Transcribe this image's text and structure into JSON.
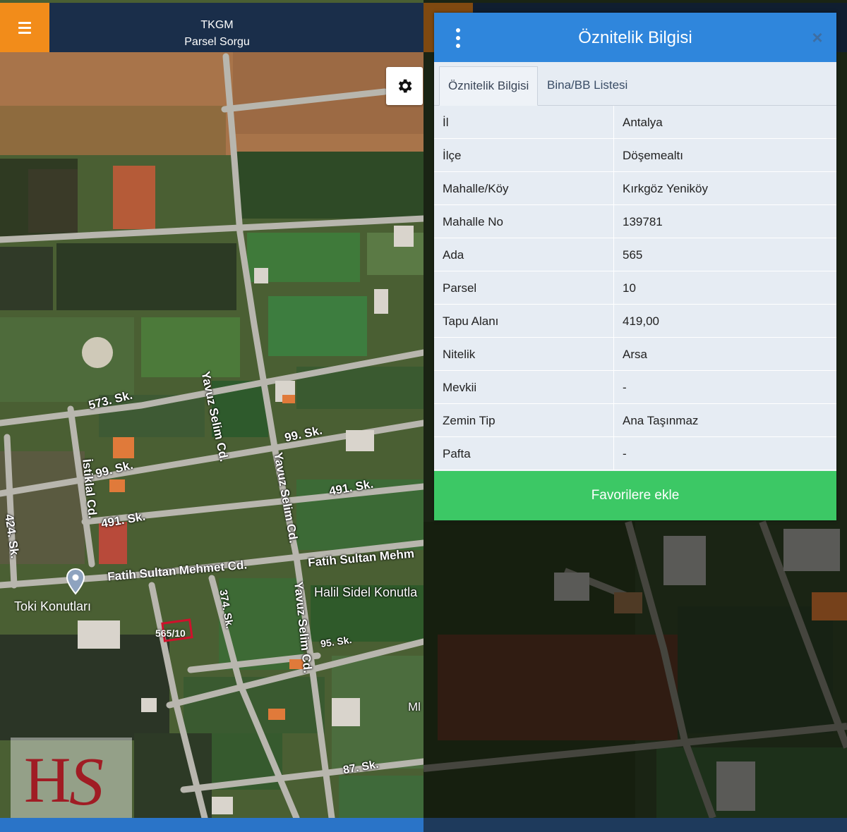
{
  "left_pane": {
    "app_title": "TKGM",
    "app_subtitle": "Parsel Sorgu",
    "map_labels": {
      "sk573": "573. Sk.",
      "yavuz1": "Yavuz Selim Cd.",
      "sk99a": "99. Sk.",
      "sk99b": "99. Sk.",
      "istiklal": "İstiklal Cd.",
      "yavuz2": "Yavuz Selim Cd.",
      "sk491a": "491. Sk.",
      "sk491b": "491. Sk.",
      "sk424": "424. Sk.",
      "fatih1": "Fatih Sultan Mehmet Cd.",
      "fatih2": "Fatih Sultan Mehm",
      "halil": "Halil Sidel Konutla",
      "toki": "Toki Konutları",
      "sk374": "374. Sk.",
      "yavuz3": "Yavuz Selim Cd.",
      "sk95": "95. Sk.",
      "sk87": "87. Sk.",
      "ml": "Ml"
    },
    "parcel_label": "565/10",
    "icons": {
      "menu": "menu-icon",
      "settings": "gear-icon",
      "location": "location-pin-icon"
    }
  },
  "dialog": {
    "title": "Öznitelik Bilgisi",
    "tabs": [
      {
        "label": "Öznitelik Bilgisi",
        "active": true
      },
      {
        "label": "Bina/BB Listesi",
        "active": false
      }
    ],
    "rows": [
      {
        "key": "İl",
        "value": "Antalya"
      },
      {
        "key": "İlçe",
        "value": "Döşemealtı"
      },
      {
        "key": "Mahalle/Köy",
        "value": "Kırkgöz Yeniköy"
      },
      {
        "key": "Mahalle No",
        "value": "139781"
      },
      {
        "key": "Ada",
        "value": "565"
      },
      {
        "key": "Parsel",
        "value": "10"
      },
      {
        "key": "Tapu Alanı",
        "value": "419,00"
      },
      {
        "key": "Nitelik",
        "value": "Arsa"
      },
      {
        "key": "Mevkii",
        "value": "-"
      },
      {
        "key": "Zemin Tip",
        "value": "Ana Taşınmaz"
      },
      {
        "key": "Pafta",
        "value": "-"
      }
    ],
    "favorite_button": "Favorilere ekle",
    "close_glyph": "×"
  },
  "colors": {
    "header_blue": "#2f86dc",
    "menu_orange": "#f28c1a",
    "favorite_green": "#3cc865",
    "topbar_navy": "#1a2e4a"
  }
}
